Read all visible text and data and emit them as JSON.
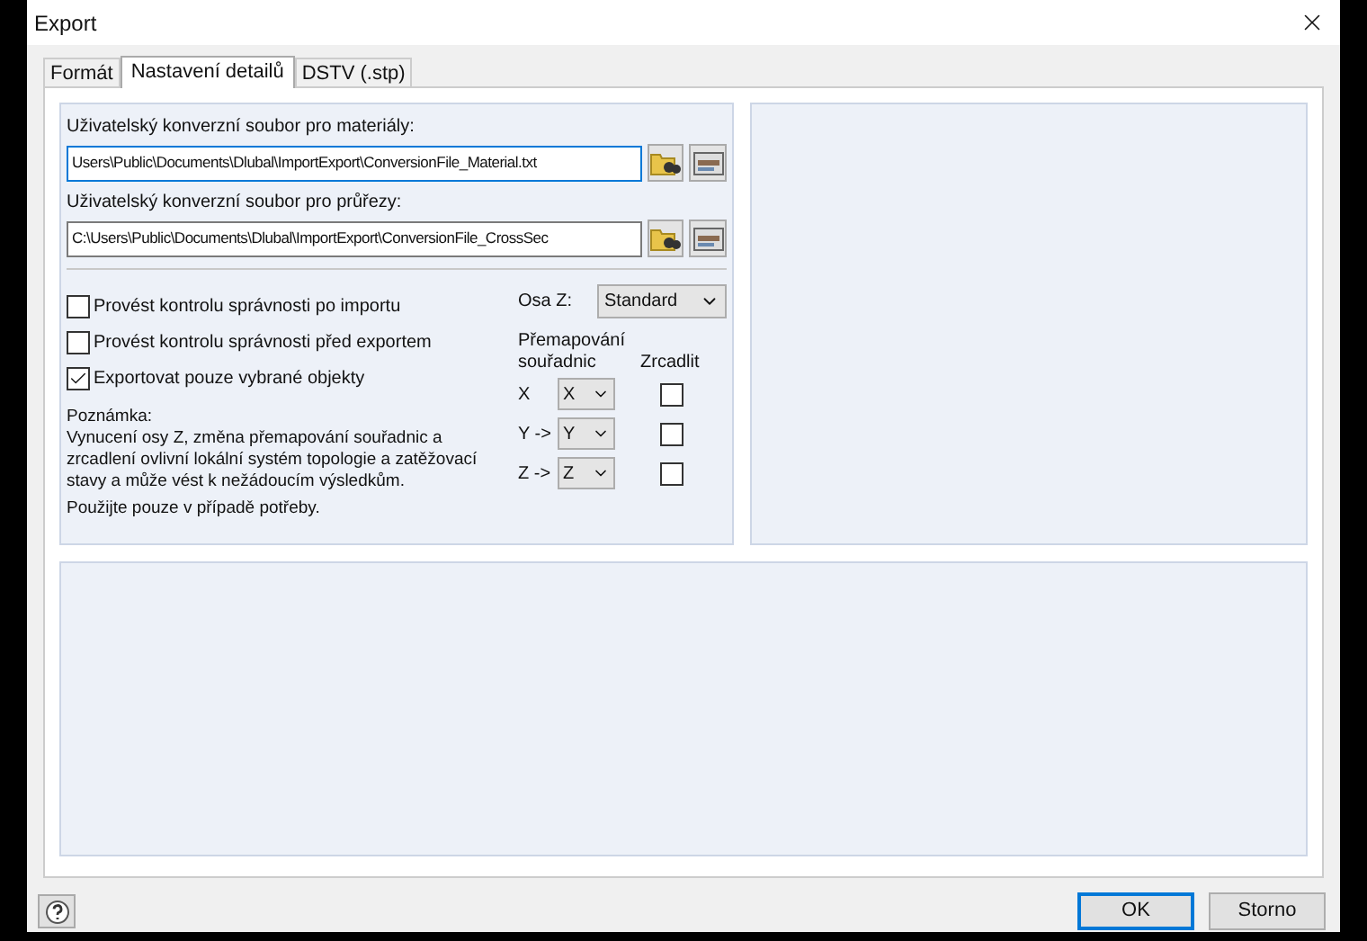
{
  "window": {
    "title": "Export"
  },
  "tabs": [
    {
      "label": "Formát",
      "selected": false
    },
    {
      "label": "Nastavení detailů",
      "selected": true
    },
    {
      "label": "DSTV (.stp)",
      "selected": false
    }
  ],
  "files": [
    {
      "label": "Uživatelský konverzní soubor pro materiály:",
      "value": "Users\\Public\\Documents\\Dlubal\\ImportExport\\ConversionFile_Material.txt",
      "focused": true
    },
    {
      "label": "Uživatelský konverzní soubor pro průřezy:",
      "value": "C:\\Users\\Public\\Documents\\Dlubal\\ImportExport\\ConversionFile_CrossSec",
      "focused": false
    }
  ],
  "checks": [
    {
      "label": "Provést kontrolu správnosti po importu",
      "checked": false
    },
    {
      "label": "Provést kontrolu správnosti před exportem",
      "checked": false
    },
    {
      "label": "Exportovat pouze vybrané objekty",
      "checked": true
    }
  ],
  "note": {
    "title": "Poznámka:",
    "text": "Vynucení osy Z, změna přemapování souřadnic a zrcadlení ovlivní lokální systém topologie a zatěžovací stavy a může vést k nežádoucím výsledkům.",
    "hint": "Použijte pouze v případě potřeby."
  },
  "axis_z": {
    "label": "Osa Z:",
    "value": "Standard"
  },
  "remap_header": "Přemapování souřadnic",
  "mirror_header": "Zrcadlit",
  "mapping": [
    {
      "label": "X",
      "value": "X",
      "mirrored": false
    },
    {
      "label": "Y ->",
      "value": "Y",
      "mirrored": false
    },
    {
      "label": "Z ->",
      "value": "Z",
      "mirrored": false
    }
  ],
  "buttons": [
    {
      "label": "OK",
      "default": true
    },
    {
      "label": "Storno",
      "default": false
    }
  ]
}
